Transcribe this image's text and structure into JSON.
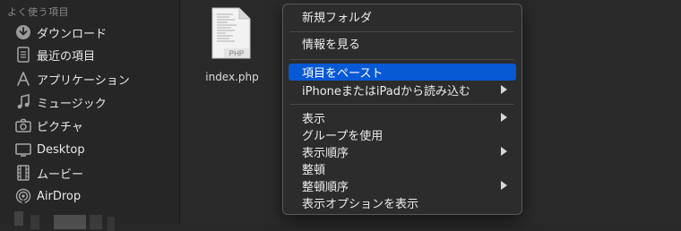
{
  "sidebar": {
    "header": "よく使う項目",
    "items": [
      {
        "label": "ダウンロード",
        "icon": "download-icon"
      },
      {
        "label": "最近の項目",
        "icon": "recents-icon"
      },
      {
        "label": "アプリケーション",
        "icon": "applications-icon"
      },
      {
        "label": "ミュージック",
        "icon": "music-note-icon"
      },
      {
        "label": "ピクチャ",
        "icon": "camera-icon"
      },
      {
        "label": "Desktop",
        "icon": "desktop-icon"
      },
      {
        "label": "ムービー",
        "icon": "film-icon"
      },
      {
        "label": "AirDrop",
        "icon": "airdrop-icon"
      }
    ]
  },
  "file": {
    "name": "index.php",
    "badge": "PHP"
  },
  "context_menu": {
    "items": [
      {
        "label": "新規フォルダ"
      },
      {
        "label": "情報を見る"
      },
      {
        "label": "項目をペースト",
        "highlighted": true
      },
      {
        "label": "iPhoneまたはiPadから読み込む",
        "submenu": true
      },
      {
        "label": "表示",
        "submenu": true
      },
      {
        "label": "グループを使用"
      },
      {
        "label": "表示順序",
        "submenu": true
      },
      {
        "label": "整頓"
      },
      {
        "label": "整頓順序",
        "submenu": true
      },
      {
        "label": "表示オプションを表示"
      }
    ],
    "highlight_color": "#0859d6"
  }
}
